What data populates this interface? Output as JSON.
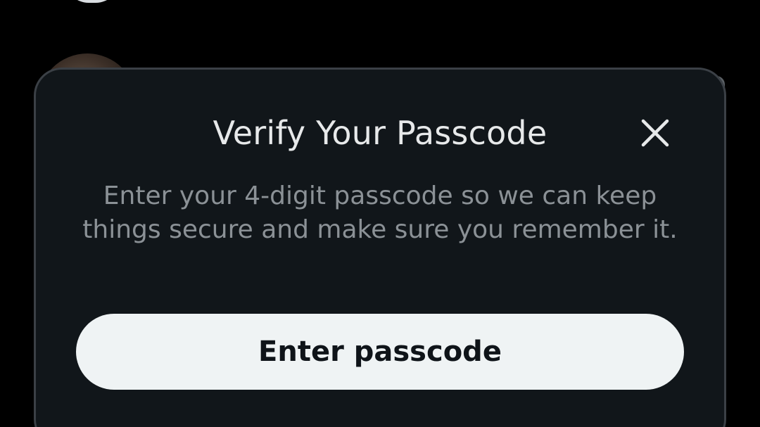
{
  "dialog": {
    "title": "Verify Your Passcode",
    "body": "Enter your 4-digit passcode so we can keep things secure and make sure you remember it.",
    "close_icon": "close-icon",
    "primary_button_label": "Enter passcode"
  },
  "colors": {
    "page_background": "#000000",
    "dialog_background": "#11161a",
    "dialog_border": "#3b4046",
    "title_text": "#e7e9ea",
    "body_text": "#8b9196",
    "button_background": "#eff3f4",
    "button_text": "#0f1419"
  }
}
